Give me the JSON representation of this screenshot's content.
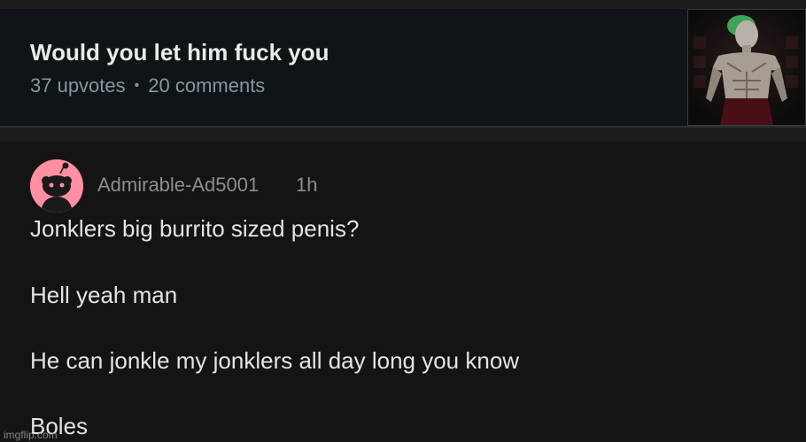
{
  "post": {
    "title": "Would you let him fuck you",
    "upvotes": "37 upvotes",
    "separator": "•",
    "comments": "20 comments",
    "thumbnail_icon": "joker-portrait-thumbnail"
  },
  "comment": {
    "avatar_icon": "reddit-snoo-avatar-icon",
    "username": "Admirable-Ad5001",
    "time": "1h",
    "lines": [
      "Jonklers big burrito sized penis?",
      "Hell yeah man",
      "He can jonkle my jonklers all day long you know",
      "Boles"
    ]
  },
  "watermark": "imgflip.com",
  "colors": {
    "background": "#141414",
    "post_card": "#0f1417",
    "avatar_pink": "#ff8fa1",
    "muted_text": "#8d8d8d"
  }
}
